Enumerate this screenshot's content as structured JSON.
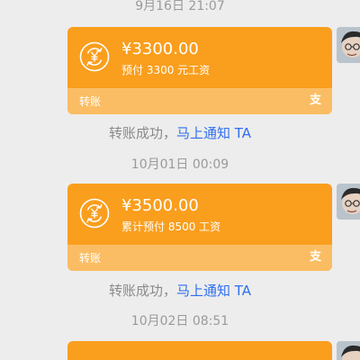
{
  "messages": [
    {
      "timestamp": "9月16日 21:07",
      "card": {
        "amount": "¥3300.00",
        "description": "预付 3300 元工资",
        "label": "转账",
        "brand_glyph": "支"
      },
      "notice": {
        "text": "转账成功，",
        "link": "马上通知 TA"
      }
    },
    {
      "timestamp": "10月01日 00:09",
      "card": {
        "amount": "¥3500.00",
        "description": "累计预付 8500 工资",
        "label": "转账",
        "brand_glyph": "支"
      },
      "notice": {
        "text": "转账成功，",
        "link": "马上通知 TA"
      }
    },
    {
      "timestamp": "10月02日 08:51"
    }
  ],
  "icons": {
    "transfer": "transfer-icon",
    "avatar": "avatar"
  },
  "colors": {
    "card_bg": "#fa9e1d",
    "card_footer": "#fbbd63",
    "link": "#2f6ff0",
    "timestamp": "#9a9a9a"
  }
}
